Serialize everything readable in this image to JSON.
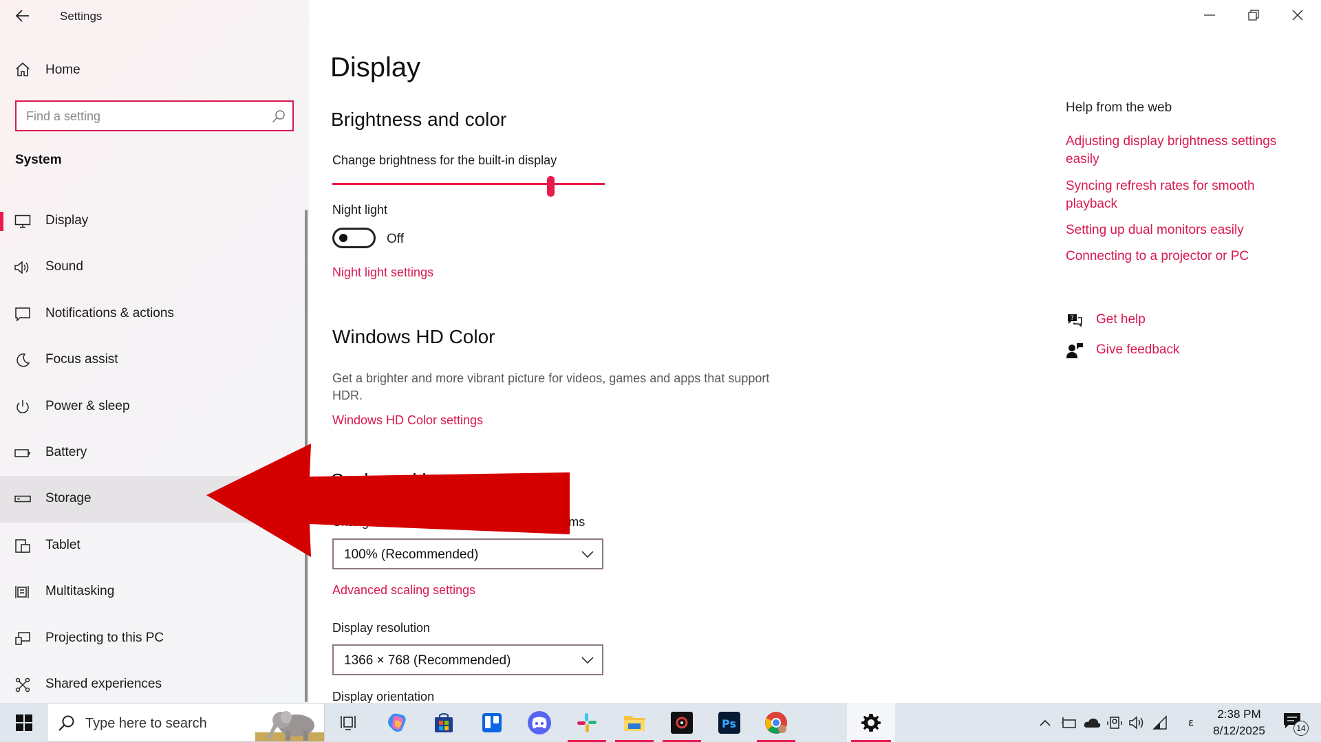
{
  "window": {
    "title": "Settings",
    "controls": [
      "minimize",
      "restore",
      "close"
    ]
  },
  "sidebar": {
    "home_label": "Home",
    "search_placeholder": "Find a setting",
    "section": "System",
    "selected": "Display",
    "hovered": "Storage",
    "items": [
      {
        "label": "Display",
        "icon": "monitor-icon"
      },
      {
        "label": "Sound",
        "icon": "speaker-icon"
      },
      {
        "label": "Notifications & actions",
        "icon": "notification-icon"
      },
      {
        "label": "Focus assist",
        "icon": "moon-icon"
      },
      {
        "label": "Power & sleep",
        "icon": "power-icon"
      },
      {
        "label": "Battery",
        "icon": "battery-icon"
      },
      {
        "label": "Storage",
        "icon": "storage-icon"
      },
      {
        "label": "Tablet",
        "icon": "tablet-icon"
      },
      {
        "label": "Multitasking",
        "icon": "multitasking-icon"
      },
      {
        "label": "Projecting to this PC",
        "icon": "projecting-icon"
      },
      {
        "label": "Shared experiences",
        "icon": "shared-icon"
      }
    ]
  },
  "main": {
    "title": "Display",
    "brightness": {
      "heading": "Brightness and color",
      "slider_label": "Change brightness for the built-in display",
      "slider_value": 0.8,
      "night_light_label": "Night light",
      "night_light_state": "Off",
      "night_light_link": "Night light settings"
    },
    "hd_color": {
      "heading": "Windows HD Color",
      "description": "Get a brighter and more vibrant picture for videos, games and apps that support HDR.",
      "link": "Windows HD Color settings"
    },
    "scale": {
      "heading": "Scale and layout",
      "size_label": "Change the size of text, apps, and other items",
      "size_value": "100% (Recommended)",
      "advanced_link": "Advanced scaling settings",
      "resolution_label": "Display resolution",
      "resolution_value": "1366 × 768 (Recommended)",
      "orientation_label": "Display orientation"
    }
  },
  "help": {
    "title": "Help from the web",
    "links": [
      "Adjusting display brightness settings easily",
      "Syncing refresh rates for smooth playback",
      "Setting up dual monitors easily",
      "Connecting to a projector or PC"
    ],
    "get_help": "Get help",
    "give_feedback": "Give feedback"
  },
  "annotation": {
    "type": "arrow",
    "color": "#d40000",
    "points_to": "Storage"
  },
  "taskbar": {
    "search_placeholder": "Type here to search",
    "apps": [
      "task-view",
      "copilot",
      "microsoft-store",
      "trello",
      "discord",
      "slack",
      "file-explorer",
      "davinci-resolve",
      "photoshop",
      "chrome",
      "settings"
    ],
    "time": "2:38 PM",
    "date": "8/12/2025",
    "notification_count": "14",
    "ime_glyph": "ε"
  },
  "colors": {
    "accent": "#e81b4d",
    "link": "#d9194f",
    "taskbar": "#dfe6ee"
  }
}
